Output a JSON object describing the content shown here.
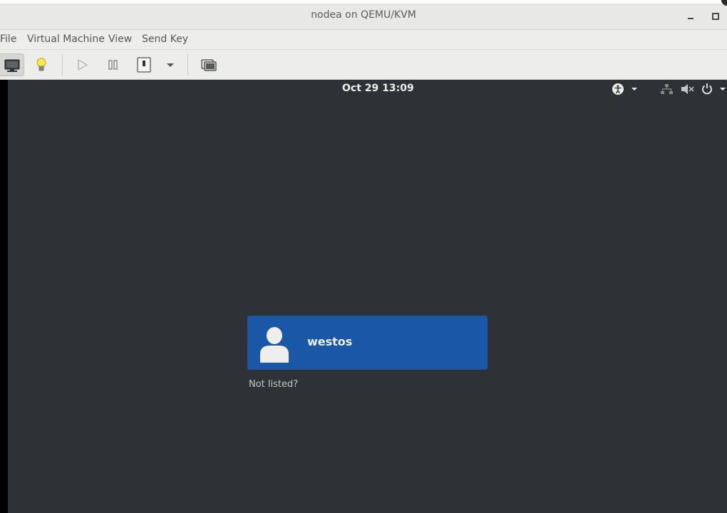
{
  "window": {
    "title": "nodea on QEMU/KVM"
  },
  "menubar": {
    "items": [
      "File",
      "Virtual Machine",
      "View",
      "Send Key"
    ]
  },
  "toolbar": {
    "buttons": [
      "console-monitor-icon",
      "lightbulb-icon",
      "play-icon",
      "pause-icon",
      "power-icon",
      "chevron-down-icon",
      "snapshot-icon"
    ]
  },
  "guest": {
    "clock": "Oct 29  13:09",
    "user": {
      "name": "westos"
    },
    "not_listed": "Not listed?"
  },
  "colors": {
    "user_card": "#1a57a6",
    "screen_bg": "#2e3236"
  }
}
